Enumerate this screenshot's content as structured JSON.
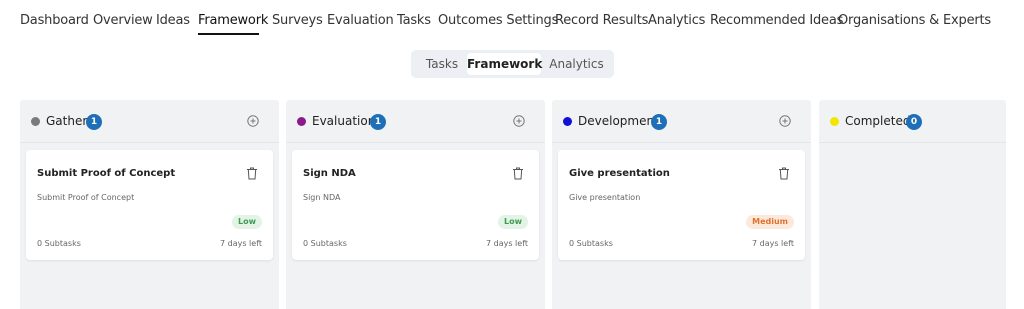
{
  "nav": {
    "items": [
      "Dashboard",
      "Overview",
      "Ideas",
      "Framework",
      "Surveys",
      "Evaluation",
      "Tasks",
      "Outcomes Settings",
      "Record Results",
      "Analytics",
      "Recommended Ideas",
      "Organisations & Experts"
    ],
    "active": "Framework"
  },
  "view_switch": {
    "options": [
      "Tasks",
      "Framework",
      "Analytics"
    ],
    "active": "Framework"
  },
  "columns": [
    {
      "title": "Gather",
      "count": "1",
      "color": "#7a7a7a",
      "card": {
        "title": "Submit Proof of Concept",
        "description": "Submit Proof of Concept",
        "priority": "Low",
        "subtasks": "0 Subtasks",
        "due": "7 days left"
      }
    },
    {
      "title": "Evaluation",
      "count": "1",
      "color": "#8b1a8b",
      "card": {
        "title": "Sign NDA",
        "description": "Sign NDA",
        "priority": "Low",
        "subtasks": "0 Subtasks",
        "due": "7 days left"
      }
    },
    {
      "title": "Development",
      "count": "1",
      "color": "#1010d8",
      "card": {
        "title": "Give presentation",
        "description": "Give presentation",
        "priority": "Medium",
        "subtasks": "0 Subtasks",
        "due": "7 days left"
      }
    },
    {
      "title": "Completed",
      "count": "0",
      "color": "#f2e600"
    }
  ],
  "colors": {
    "accent": "#1f6fb8",
    "low_bg": "#e3f3e6",
    "low_fg": "#3f9a52",
    "medium_bg": "#fde9dc",
    "medium_fg": "#e0732e"
  },
  "icons": {
    "add": "plus-circle-icon",
    "delete": "trash-icon"
  }
}
